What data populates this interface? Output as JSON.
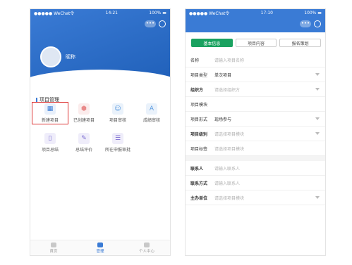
{
  "left": {
    "status": {
      "carrier": "●●●●● WeChat令",
      "time": "14:21",
      "battery": "100% ▬"
    },
    "nav": {
      "dots": "•••"
    },
    "user": {
      "name": "昵称"
    },
    "section_title": "项目管理",
    "tiles": [
      {
        "label": "新建项目",
        "icon": "new-doc-icon",
        "color": "#3a7bd5"
      },
      {
        "label": "已创建项目",
        "icon": "cube-icon",
        "color": "#e98a8a"
      },
      {
        "label": "项目审核",
        "icon": "person-icon",
        "color": "#5b9be0"
      },
      {
        "label": "成绩审核",
        "icon": "grade-icon",
        "color": "#5b9be0"
      },
      {
        "label": "项目总结",
        "icon": "bookmark-icon",
        "color": "#7a6bd0"
      },
      {
        "label": "总结评价",
        "icon": "edit-icon",
        "color": "#7a6bd0"
      },
      {
        "label": "所在申报审批",
        "icon": "list-icon",
        "color": "#7a6bd0"
      }
    ],
    "tabs": [
      {
        "label": "首页"
      },
      {
        "label": "管理"
      },
      {
        "label": "个人中心"
      }
    ]
  },
  "right": {
    "status": {
      "carrier": "●●●●● WeChat令",
      "time": "17:10",
      "battery": "100% ▬"
    },
    "nav": {
      "dots": "•••"
    },
    "steps": [
      "基本信息",
      "项目内容",
      "报名策划"
    ],
    "fields": [
      {
        "label": "名称",
        "value": "请输入项目名称",
        "placeholder": true,
        "dropdown": false,
        "required": false
      },
      {
        "label": "项目类型",
        "value": "单次项目",
        "placeholder": false,
        "dropdown": true,
        "required": false
      },
      {
        "label": "组织方",
        "value": "请选择组织方",
        "placeholder": true,
        "dropdown": true,
        "required": true
      },
      {
        "label": "项目模块",
        "value": "",
        "placeholder": true,
        "dropdown": false,
        "required": false
      },
      {
        "label": "项目形式",
        "value": "现场参与",
        "placeholder": false,
        "dropdown": true,
        "required": false
      },
      {
        "label": "项目级别",
        "value": "请选择项目模块",
        "placeholder": true,
        "dropdown": true,
        "required": true
      },
      {
        "label": "项目标签",
        "value": "请选择项目模块",
        "placeholder": true,
        "dropdown": false,
        "required": false
      }
    ],
    "contact_fields": [
      {
        "label": "联系人",
        "value": "请输入联系人",
        "required": true,
        "dropdown": false
      },
      {
        "label": "联系方式",
        "value": "请输入联系人",
        "required": true,
        "dropdown": false
      },
      {
        "label": "主办单位",
        "value": "请选择项目模块",
        "required": true,
        "dropdown": true
      }
    ]
  }
}
